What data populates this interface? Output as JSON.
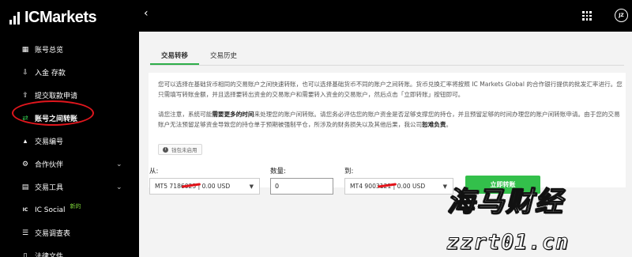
{
  "brand": {
    "name": "ICMarkets"
  },
  "sidebar": {
    "items": [
      {
        "label": "账号总览",
        "icon": "overview-icon",
        "glyph": "▦"
      },
      {
        "label": "入金 存款",
        "icon": "deposit-icon",
        "glyph": "⇩"
      },
      {
        "label": "提交取款申请",
        "icon": "withdraw-icon",
        "glyph": "⇧"
      },
      {
        "label": "账号之间转账",
        "icon": "transfer-icon",
        "glyph": "⇄",
        "active": true
      },
      {
        "label": "交易编号",
        "icon": "chart-icon",
        "glyph": "▴"
      },
      {
        "label": "合作伙伴",
        "icon": "partner-icon",
        "glyph": "⚙",
        "chevron": "⌄"
      },
      {
        "label": "交易工具",
        "icon": "tools-icon",
        "glyph": "▤",
        "chevron": "⌄"
      },
      {
        "label": "IC Social",
        "icon": "ic-social-icon",
        "glyph": "IC",
        "badge": "新的"
      },
      {
        "label": "交易调查表",
        "icon": "survey-icon",
        "glyph": "☰"
      },
      {
        "label": "法律文件",
        "icon": "legal-icon",
        "glyph": "▯"
      }
    ],
    "active_color": "#32c24d"
  },
  "header": {
    "back": "‹",
    "avatar": "JZ"
  },
  "tabs": [
    {
      "label": "交易转移",
      "active": true
    },
    {
      "label": "交易历史",
      "active": false
    }
  ],
  "info": {
    "para1": "您可以选择在基础货币相同的交易账户之间快速转账，也可以选择基础货币不同的账户之间转账。货币兑换汇率将按照 IC Markets Global 的合作银行提供的批发汇率进行。您只需填写转账金额，并且选择要转出资金的交易账户和需要转入资金的交易账户，然后点击「立即转账」按钮即可。",
    "para2_pre": "请您注意，系统可能",
    "para2_bold": "需要更多的时间",
    "para2_mid": "来处理您的账户间转账。请您务必评估您的账户资金是否足够支撑您的持仓，并且预留足够的时间办理您的账户间转账申请。由于您的交易账户无法预留足够资金导致您的持仓单于预期被强制平仓，所涉及的财务损失以及其他后果，我公司",
    "para2_end": "恕难负责",
    "para2_tail": "。",
    "wallet_note": "钱包未启用"
  },
  "form": {
    "from_label": "从:",
    "from_value": "MT5 7186023 | 0.00 USD",
    "amount_label": "数量:",
    "amount_value": "0",
    "to_label": "到:",
    "to_value": "MT4 9003121 | 0.00 USD",
    "submit_label": "立即转账"
  },
  "watermark": {
    "title": "海马财经",
    "url": "zzrt01.cn"
  },
  "colors": {
    "accent": "#33c04b",
    "sidebar_bg": "#000000",
    "highlight_ring": "#e0161d"
  }
}
